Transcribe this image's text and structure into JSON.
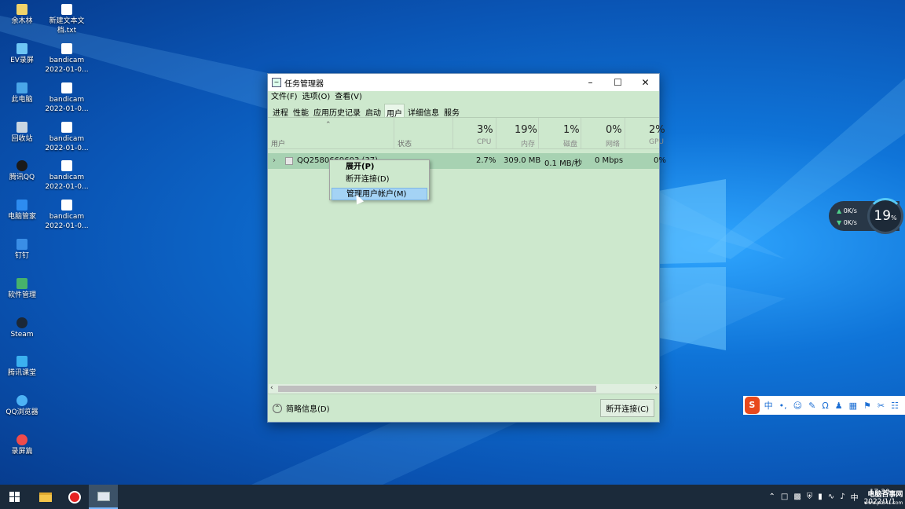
{
  "desktop": {
    "icons_col1": [
      "余木林",
      "EV录屏",
      "此电脑",
      "回收站",
      "腾讯QQ",
      "电脑管家",
      "钉钉",
      "软件管理",
      "Steam",
      "腾讯课堂",
      "QQ浏览器",
      "录屏篇"
    ],
    "icons_col2": [
      {
        "l1": "新建文本文",
        "l2": "档.txt"
      },
      {
        "l1": "bandicam",
        "l2": "2022-01-0..."
      },
      {
        "l1": "bandicam",
        "l2": "2022-01-0..."
      },
      {
        "l1": "bandicam",
        "l2": "2022-01-0..."
      },
      {
        "l1": "bandicam",
        "l2": "2022-01-0..."
      },
      {
        "l1": "bandicam",
        "l2": "2022-01-0..."
      }
    ]
  },
  "task_manager": {
    "title": "任务管理器",
    "menu": [
      "文件(F)",
      "选项(O)",
      "查看(V)"
    ],
    "tabs": [
      "进程",
      "性能",
      "应用历史记录",
      "启动",
      "用户",
      "详细信息",
      "服务"
    ],
    "active_tab": "用户",
    "columns": {
      "user": "用户",
      "status": "状态",
      "cpu": {
        "pct": "3%",
        "label": "CPU"
      },
      "mem": {
        "pct": "19%",
        "label": "内存"
      },
      "disk": {
        "pct": "1%",
        "label": "磁盘"
      },
      "net": {
        "pct": "0%",
        "label": "网络"
      },
      "gpu": {
        "pct": "2%",
        "label": "GPU"
      }
    },
    "row": {
      "name": "QQ2580669603 (37)",
      "cpu": "2.7%",
      "mem": "309.0 MB",
      "disk": "0.1 MB/秒",
      "net": "0 Mbps",
      "gpu": "0%"
    },
    "footer": {
      "fewer_details": "简略信息(D)",
      "disconnect_button": "断开连接(C)"
    }
  },
  "context_menu": [
    "展开(P)",
    "断开连接(D)",
    "管理用户帐户(M)"
  ],
  "net_widget": {
    "up": "0K/s",
    "down": "0K/s",
    "percent": "19",
    "unit": "%"
  },
  "ime_toolbar": {
    "logo": "S",
    "lang": "中",
    "punct": "•,"
  },
  "taskbar": {
    "tray_lang": "中",
    "time": "17:30",
    "date": "2022/1/1"
  },
  "watermark": {
    "line1": "电脑百事网",
    "line2": "www.pc841.com"
  }
}
